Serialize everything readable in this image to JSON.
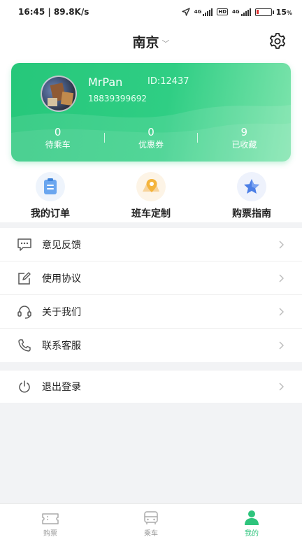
{
  "status_bar": {
    "time_speed": "16:45 | 89.8K/s",
    "network_1": "4G",
    "network_2": "4G",
    "hd": "HD",
    "battery_text": "15",
    "battery_level": 0.15
  },
  "header": {
    "city": "南京"
  },
  "profile": {
    "username": "MrPan",
    "id_text": "ID:12437",
    "phone": "18839399692",
    "stats": [
      {
        "value": "0",
        "label": "待乘车"
      },
      {
        "value": "0",
        "label": "优惠券"
      },
      {
        "value": "9",
        "label": "已收藏"
      }
    ]
  },
  "quick_actions": [
    {
      "label": "我的订单",
      "icon": "order-icon"
    },
    {
      "label": "班车定制",
      "icon": "location-pin-icon"
    },
    {
      "label": "购票指南",
      "icon": "star-icon"
    }
  ],
  "menu": [
    {
      "label": "意见反馈",
      "icon": "chat-icon"
    },
    {
      "label": "使用协议",
      "icon": "edit-document-icon"
    },
    {
      "label": "关于我们",
      "icon": "headset-icon"
    },
    {
      "label": "联系客服",
      "icon": "phone-icon"
    }
  ],
  "logout": {
    "label": "退出登录",
    "icon": "power-icon"
  },
  "tabbar": [
    {
      "label": "购票",
      "icon": "ticket-icon"
    },
    {
      "label": "乘车",
      "icon": "bus-icon"
    },
    {
      "label": "我的",
      "icon": "user-icon"
    }
  ],
  "colors": {
    "brand": "#2ec47c",
    "text": "#222222",
    "muted": "#999999",
    "page_bg": "#f2f3f5",
    "battery_low": "#e03030"
  }
}
